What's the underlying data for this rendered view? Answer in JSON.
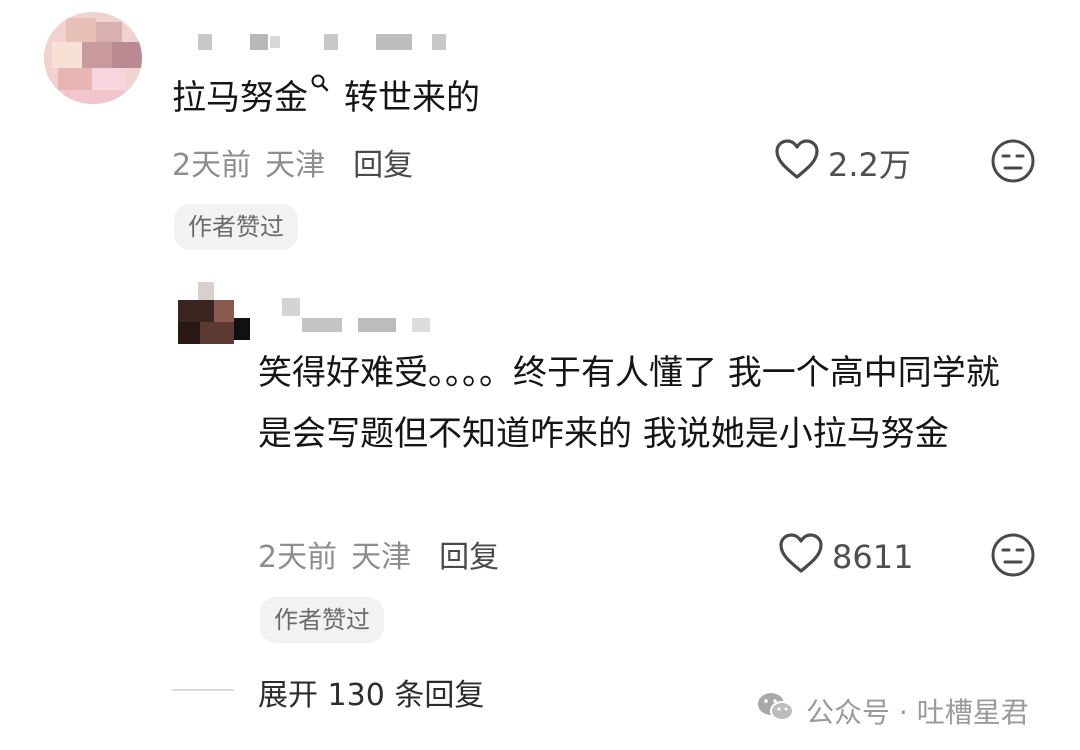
{
  "comment": {
    "text_before": "拉马努金",
    "text_after": "转世来的",
    "time": "2天前",
    "location": "天津",
    "reply_label": "回复",
    "likes": "2.2万",
    "author_badge": "作者赞过"
  },
  "reply": {
    "text": "笑得好难受。。。。终于有人懂了 我一个高中同学就是会写题但不知道咋来的 我说她是小拉马努金",
    "time": "2天前",
    "location": "天津",
    "reply_label": "回复",
    "likes": "8611",
    "author_badge": "作者赞过"
  },
  "expand": {
    "label": "展开 130 条回复"
  },
  "watermark": {
    "text": "公众号 · 吐槽星君"
  },
  "icons": {
    "like": "heart-outline-icon",
    "dislike": "neutral-face-icon",
    "search": "search-icon",
    "wechat": "wechat-icon"
  },
  "colors": {
    "text": "#151515",
    "meta": "#8e8e8e",
    "badge_bg": "#f2f2f2"
  }
}
